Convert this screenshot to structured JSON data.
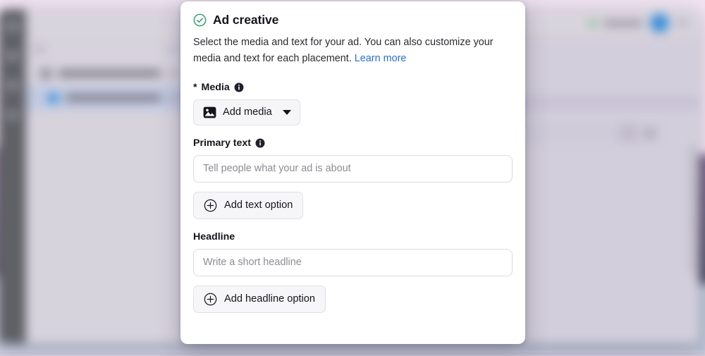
{
  "modal": {
    "status_icon": "check-circle-icon",
    "status_color": "#2e9e6b",
    "title": "Ad creative",
    "description_part1": "Select the media and text for your ad. You can also customize your media and text for each placement. ",
    "learn_more_label": "Learn more",
    "link_color": "#2a6fd6",
    "fields": {
      "media": {
        "required_marker": "*",
        "label": "Media",
        "info_icon": "info-icon",
        "button_label": "Add media",
        "button_icon": "image-icon",
        "button_chevron": "chevron-down-icon"
      },
      "primary_text": {
        "label": "Primary text",
        "info_icon": "info-icon",
        "input_value": "",
        "input_placeholder": "Tell people what your ad is about",
        "add_option_label": "Add text option",
        "add_option_icon": "plus-circle-icon"
      },
      "headline": {
        "label": "Headline",
        "input_value": "",
        "input_placeholder": "Write a short headline",
        "add_option_label": "Add headline option",
        "add_option_icon": "plus-circle-icon"
      }
    }
  },
  "background": {
    "window_rail_icons": [
      "grid-icon",
      "chart-icon",
      "edit-icon",
      "settings-icon"
    ],
    "status_dot_color": "#39b54a",
    "avatar_color": "#1e7fd4",
    "selected_row_color": "#b9c3dd",
    "illustration": "briefcase-illustration",
    "illustration_color": "#79c0b2"
  }
}
